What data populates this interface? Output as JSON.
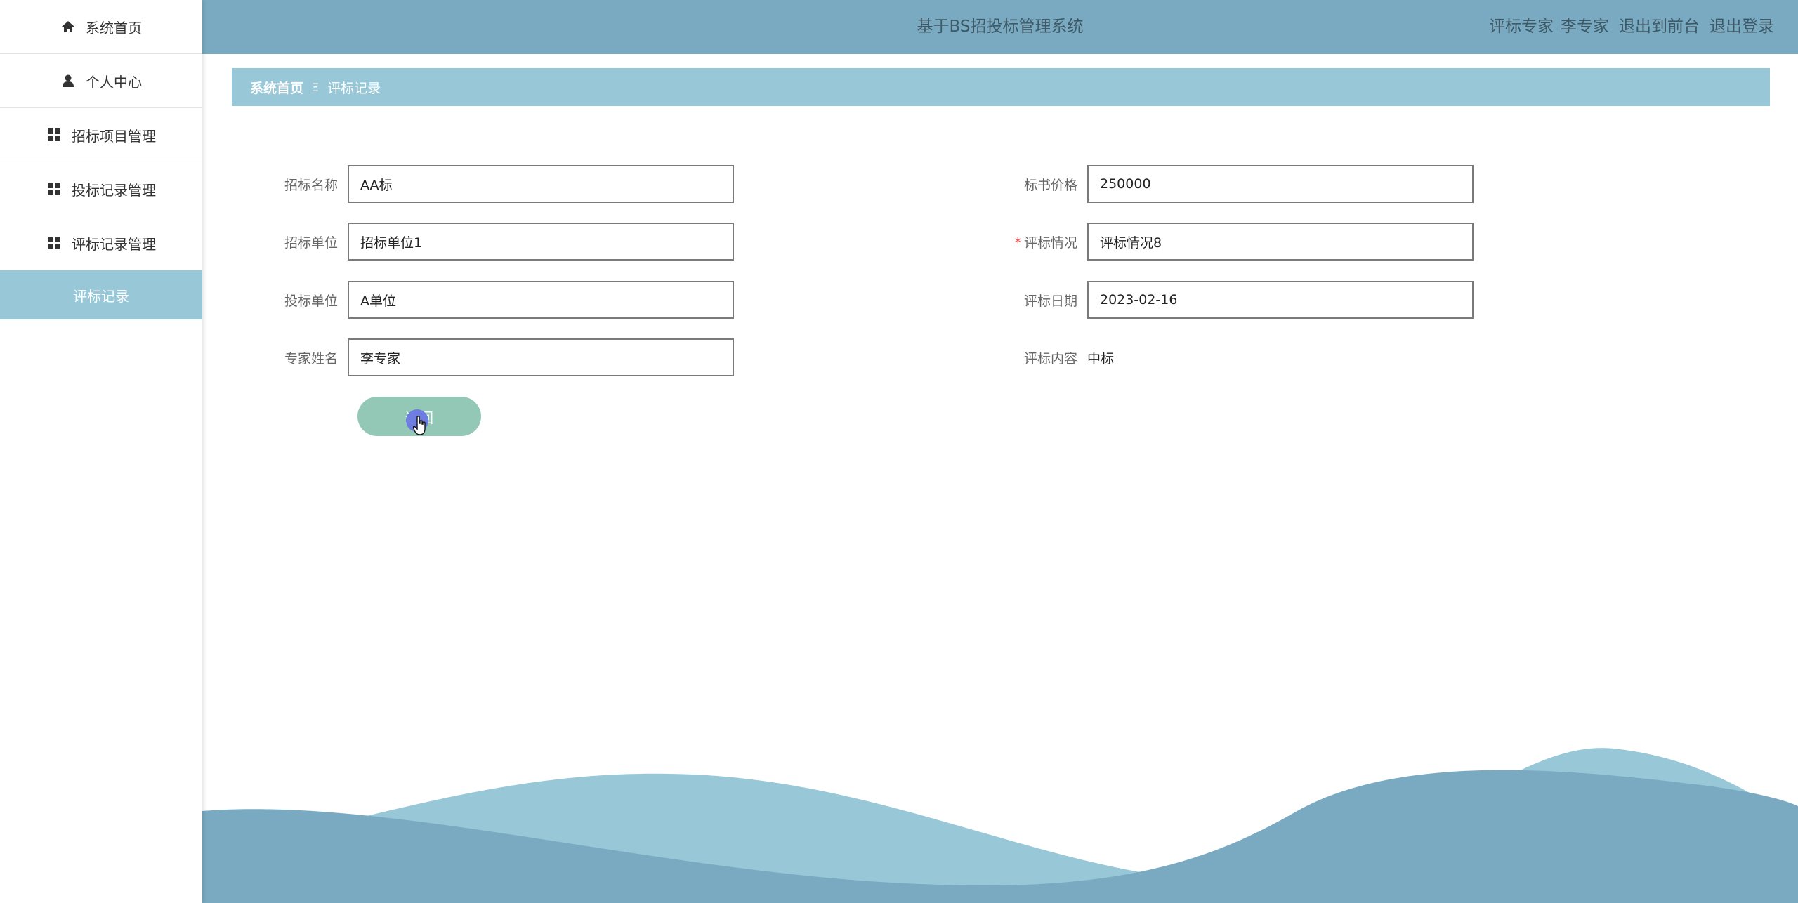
{
  "sidebar": {
    "items": [
      {
        "label": "系统首页",
        "icon": "home-icon"
      },
      {
        "label": "个人中心",
        "icon": "user-icon"
      },
      {
        "label": "招标项目管理",
        "icon": "grid-icon"
      },
      {
        "label": "投标记录管理",
        "icon": "grid-icon"
      },
      {
        "label": "评标记录管理",
        "icon": "grid-icon"
      }
    ],
    "active_sub": "评标记录"
  },
  "header": {
    "title": "基于BS招投标管理系统",
    "role": "评标专家",
    "username": "李专家",
    "exit_front": "退出到前台",
    "logout": "退出登录"
  },
  "breadcrumb": {
    "home": "系统首页",
    "separator": "Ξ",
    "current": "评标记录"
  },
  "form": {
    "tender_name": {
      "label": "招标名称",
      "value": "AA标"
    },
    "tender_unit": {
      "label": "招标单位",
      "value": "招标单位1"
    },
    "bid_unit": {
      "label": "投标单位",
      "value": "A单位"
    },
    "expert_name": {
      "label": "专家姓名",
      "value": "李专家"
    },
    "bid_price": {
      "label": "标书价格",
      "value": "250000"
    },
    "eval_status": {
      "label": "评标情况",
      "value": "评标情况8",
      "required_mark": "*"
    },
    "eval_date": {
      "label": "评标日期",
      "value": "2023-02-16"
    },
    "eval_content": {
      "label": "评标内容",
      "value": "中标"
    },
    "return_button": "返回"
  },
  "colors": {
    "header_bg": "#79aac1",
    "accent": "#98c8d7",
    "button": "#93c8b7",
    "wave_light": "#98c8d7",
    "wave_dark": "#79aac1"
  }
}
